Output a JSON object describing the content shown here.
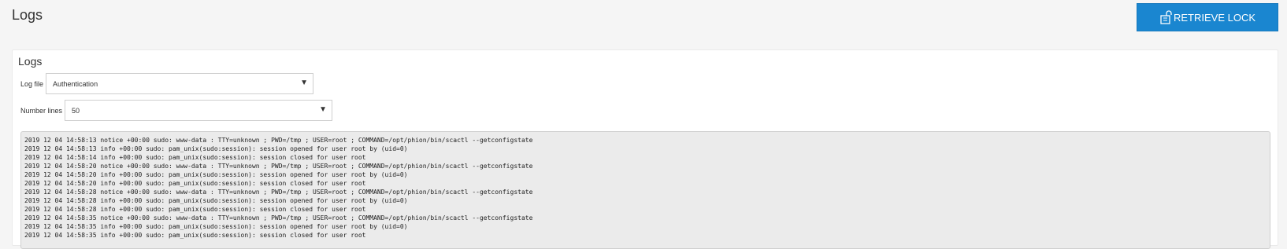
{
  "header": {
    "title": "Logs",
    "retrieve_label": "RETRIEVE LOCK"
  },
  "panel": {
    "title": "Logs",
    "log_file": {
      "label": "Log file",
      "value": "Authentication"
    },
    "number_lines": {
      "label": "Number lines",
      "value": "50"
    },
    "log_lines": [
      "2019 12 04 14:58:13 notice +00:00 sudo: www-data : TTY=unknown ; PWD=/tmp ; USER=root ; COMMAND=/opt/phion/bin/scactl --getconfigstate",
      "2019 12 04 14:58:13 info +00:00 sudo: pam_unix(sudo:session): session opened for user root by (uid=0)",
      "2019 12 04 14:58:14 info +00:00 sudo: pam_unix(sudo:session): session closed for user root",
      "2019 12 04 14:58:20 notice +00:00 sudo: www-data : TTY=unknown ; PWD=/tmp ; USER=root ; COMMAND=/opt/phion/bin/scactl --getconfigstate",
      "2019 12 04 14:58:20 info +00:00 sudo: pam_unix(sudo:session): session opened for user root by (uid=0)",
      "2019 12 04 14:58:20 info +00:00 sudo: pam_unix(sudo:session): session closed for user root",
      "2019 12 04 14:58:28 notice +00:00 sudo: www-data : TTY=unknown ; PWD=/tmp ; USER=root ; COMMAND=/opt/phion/bin/scactl --getconfigstate",
      "2019 12 04 14:58:28 info +00:00 sudo: pam_unix(sudo:session): session opened for user root by (uid=0)",
      "2019 12 04 14:58:28 info +00:00 sudo: pam_unix(sudo:session): session closed for user root",
      "2019 12 04 14:58:35 notice +00:00 sudo: www-data : TTY=unknown ; PWD=/tmp ; USER=root ; COMMAND=/opt/phion/bin/scactl --getconfigstate",
      "2019 12 04 14:58:35 info +00:00 sudo: pam_unix(sudo:session): session opened for user root by (uid=0)",
      "2019 12 04 14:58:35 info +00:00 sudo: pam_unix(sudo:session): session closed for user root"
    ]
  }
}
